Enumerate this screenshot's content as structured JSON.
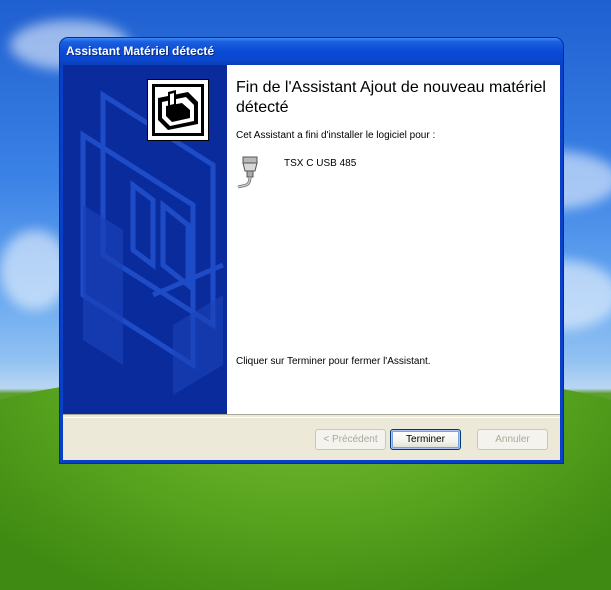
{
  "window": {
    "title": "Assistant Matériel détecté"
  },
  "content": {
    "heading": "Fin de l'Assistant Ajout de nouveau matériel détecté",
    "intro": "Cet Assistant a fini d'installer le logiciel pour :",
    "device_name": "TSX C USB 485",
    "device_icon": "serial-cable-icon",
    "finish_text": "Cliquer sur Terminer pour fermer l'Assistant."
  },
  "buttons": {
    "back": "< Précédent",
    "finish": "Terminer",
    "cancel": "Annuler"
  },
  "colors": {
    "sidebar": "#0a2b9c",
    "titlebar": "#0a4ad6",
    "dialog_bg": "#ece9d8"
  }
}
